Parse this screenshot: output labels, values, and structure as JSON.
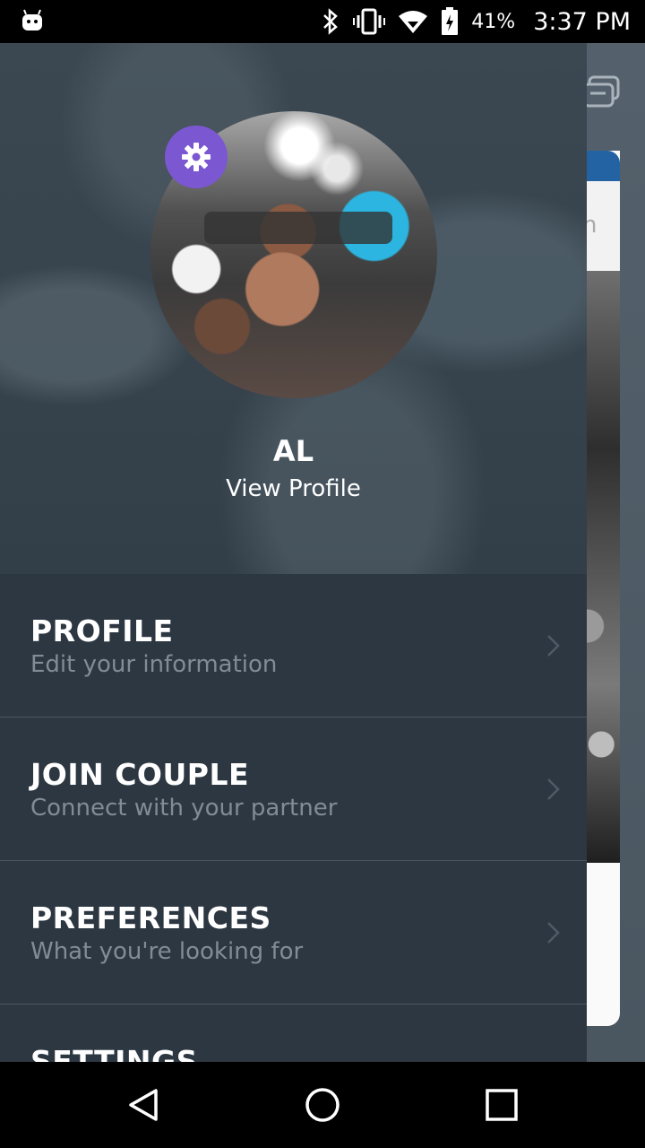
{
  "status_bar": {
    "battery_percent": "41%",
    "time": "3:37 PM",
    "icons": [
      "android-icon",
      "bluetooth-icon",
      "vibrate-icon",
      "wifi-icon",
      "battery-icon"
    ]
  },
  "drawer": {
    "user_name": "AL",
    "view_profile_label": "View Profile",
    "settings_icon": "gear-icon",
    "accent_color": "#7b57d1",
    "menu": [
      {
        "title": "PROFILE",
        "subtitle": "Edit your information"
      },
      {
        "title": "JOIN COUPLE",
        "subtitle": "Connect with your partner"
      },
      {
        "title": "PREFERENCES",
        "subtitle": "What you're looking for"
      },
      {
        "title": "SETTINGS",
        "subtitle": ""
      }
    ]
  },
  "background_app": {
    "search_hint_fragment": "h"
  },
  "nav_bar": {
    "icons": [
      "back-icon",
      "home-icon",
      "recents-icon"
    ]
  }
}
